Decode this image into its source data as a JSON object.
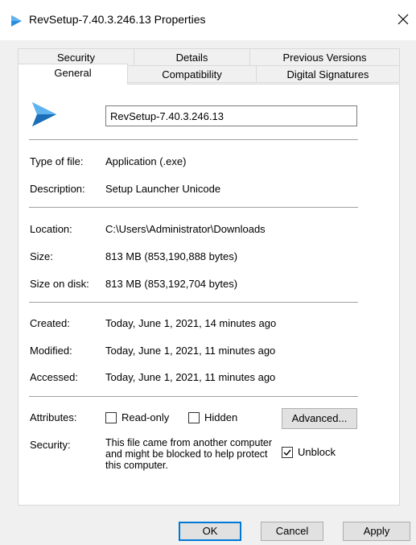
{
  "window": {
    "title": "RevSetup-7.40.3.246.13 Properties",
    "close_glyph": "✕"
  },
  "tabs": {
    "row1": [
      "Security",
      "Details",
      "Previous Versions"
    ],
    "row2": [
      "General",
      "Compatibility",
      "Digital Signatures"
    ],
    "active": "General"
  },
  "general": {
    "file_name": "RevSetup-7.40.3.246.13",
    "type_label": "Type of file:",
    "type_value": "Application (.exe)",
    "description_label": "Description:",
    "description_value": "Setup Launcher Unicode",
    "location_label": "Location:",
    "location_value": "C:\\Users\\Administrator\\Downloads",
    "size_label": "Size:",
    "size_value": "813 MB (853,190,888 bytes)",
    "size_on_disk_label": "Size on disk:",
    "size_on_disk_value": "813 MB (853,192,704 bytes)",
    "created_label": "Created:",
    "created_value": "Today, June 1, 2021, 14 minutes ago",
    "modified_label": "Modified:",
    "modified_value": "Today, June 1, 2021, 11 minutes ago",
    "accessed_label": "Accessed:",
    "accessed_value": "Today, June 1, 2021, 11 minutes ago",
    "attributes_label": "Attributes:",
    "readonly_label": "Read-only",
    "readonly_checked": false,
    "hidden_label": "Hidden",
    "hidden_checked": false,
    "advanced_label": "Advanced...",
    "security_label": "Security:",
    "security_text": "This file came from another computer and might be blocked to help protect this computer.",
    "unblock_label": "Unblock",
    "unblock_checked": true
  },
  "buttons": {
    "ok": "OK",
    "cancel": "Cancel",
    "apply": "Apply"
  },
  "colors": {
    "icon_blue": "#2b8fe0",
    "icon_blue_dark": "#1b6fb8",
    "accent": "#0078d7"
  }
}
